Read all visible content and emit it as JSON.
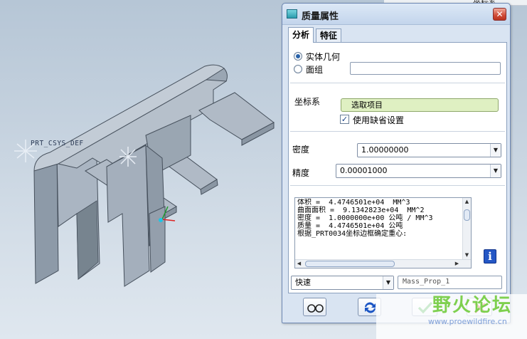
{
  "viewport": {
    "csys_label": "PRT_CSYS_DEF",
    "top_strip_label": "坐标系"
  },
  "dialog": {
    "title": "质量属性",
    "tabs": [
      "分析",
      "特征"
    ],
    "geometry_options": [
      {
        "label": "实体几何",
        "selected": true
      },
      {
        "label": "面组",
        "selected": false
      }
    ],
    "quilt_value": "",
    "csys_label": "坐标系",
    "csys_selector": "选取项目",
    "use_default_checkbox": {
      "label": "使用缺省设置",
      "checked": true
    },
    "density": {
      "label": "密度",
      "value": "1.00000000"
    },
    "accuracy": {
      "label": "精度",
      "value": "0.00001000"
    },
    "results_lines": [
      "体积 =  4.4746501e+04  MM^3",
      "曲面面积 =  9.1342823e+04  MM^2",
      "密度 =  1.0000000e+00 公吨 / MM^3",
      "质量 =  4.4746501e+04 公吨",
      "",
      "根据_PRT0034坐标边框确定重心:"
    ],
    "mode_select": "快速",
    "analysis_name": "Mass_Prop_1",
    "footer": {
      "preview_icon": "glasses-icon",
      "repeat_icon": "refresh-arrows-icon",
      "ok_icon": "check-icon",
      "cancel_icon": "cancel-x-icon"
    }
  },
  "watermark": {
    "title": "野火论坛",
    "url": "www.proewildfire.cn"
  }
}
